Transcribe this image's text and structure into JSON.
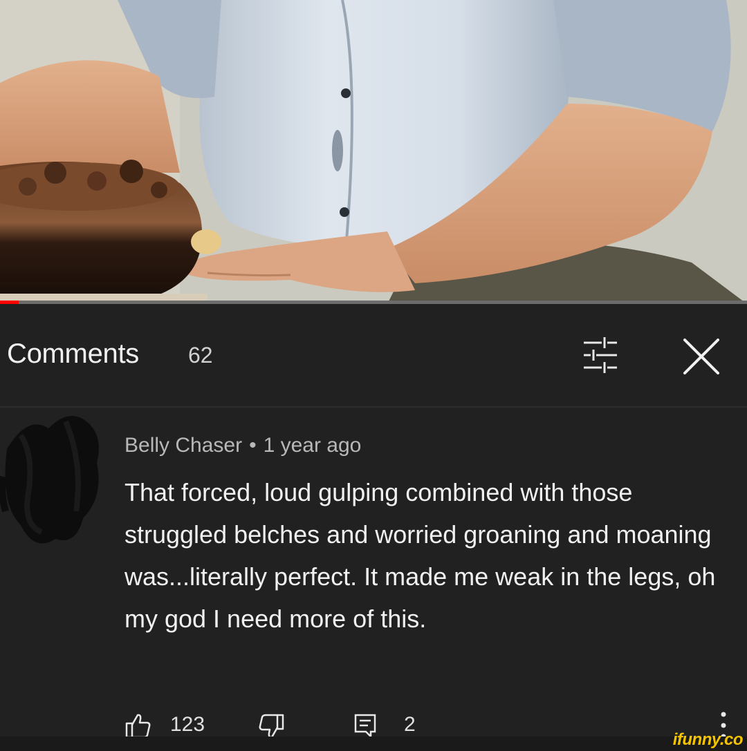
{
  "video": {
    "progress_fraction": 0.025
  },
  "comments_header": {
    "title": "Comments",
    "count": "62",
    "sort_icon": "sort-filter-icon",
    "close_icon": "close-icon"
  },
  "comment": {
    "author": "Belly Chaser",
    "separator": "•",
    "time": "1 year ago",
    "text": "That forced, loud gulping combined with those struggled belches and worried groaning and moaning was...literally perfect.  It made me weak in the legs, oh my god I need more of this.",
    "likes": "123",
    "replies": "2"
  },
  "watermark": "ifunny.co",
  "colors": {
    "background": "#212121",
    "text_primary": "#f1f1f1",
    "text_secondary": "#b8b8b8",
    "progress": "#ff0000",
    "watermark": "#f5c400"
  }
}
